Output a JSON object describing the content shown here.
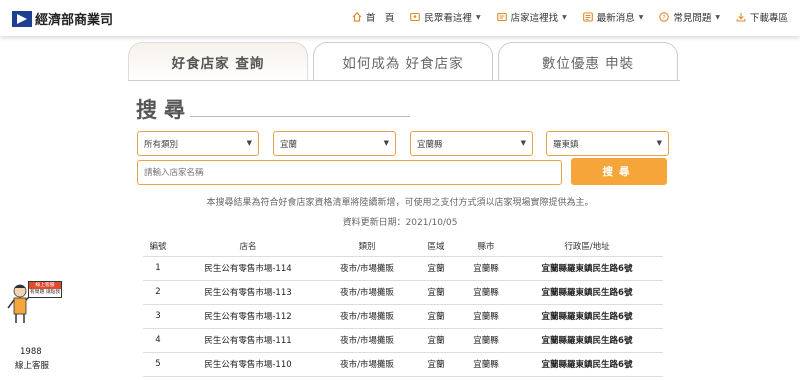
{
  "header": {
    "logo_text": "經濟部商業司",
    "nav": [
      {
        "label": "首　頁",
        "icon": "home-icon"
      },
      {
        "label": "民眾看這裡",
        "icon": "people-icon"
      },
      {
        "label": "店家這裡找",
        "icon": "shop-icon"
      },
      {
        "label": "最新消息",
        "icon": "news-icon"
      },
      {
        "label": "常見問題",
        "icon": "question-icon"
      },
      {
        "label": "下載專區",
        "icon": "download-icon"
      }
    ]
  },
  "tabs": [
    {
      "label": "好食店家 查詢",
      "active": true
    },
    {
      "label": "如何成為 好食店家",
      "active": false
    },
    {
      "label": "數位優惠 申裝",
      "active": false
    }
  ],
  "search": {
    "title": "搜尋",
    "category": "所有類別",
    "area": "宜蘭",
    "county": "宜蘭縣",
    "district": "羅東鎮",
    "keyword_placeholder": "請輸入店家名稱",
    "button": "搜尋",
    "note": "本搜尋結果為符合好食店家資格清單將陸續新增，可使用之支付方式須以店家現場實際提供為主。",
    "updated": "資料更新日期：2021/10/05"
  },
  "table": {
    "headers": [
      "編號",
      "店名",
      "類別",
      "區域",
      "縣市",
      "行政區/地址"
    ],
    "rows": [
      [
        "1",
        "民生公有零售市場-114",
        "夜市/市場攤販",
        "宜蘭",
        "宜蘭縣",
        "宜蘭縣羅東鎮民生路6號"
      ],
      [
        "2",
        "民生公有零售市場-113",
        "夜市/市場攤販",
        "宜蘭",
        "宜蘭縣",
        "宜蘭縣羅東鎮民生路6號"
      ],
      [
        "3",
        "民生公有零售市場-112",
        "夜市/市場攤販",
        "宜蘭",
        "宜蘭縣",
        "宜蘭縣羅東鎮民生路6號"
      ],
      [
        "4",
        "民生公有零售市場-111",
        "夜市/市場攤販",
        "宜蘭",
        "宜蘭縣",
        "宜蘭縣羅東鎮民生路6號"
      ],
      [
        "5",
        "民生公有零售市場-110",
        "夜市/市場攤販",
        "宜蘭",
        "宜蘭縣",
        "宜蘭縣羅東鎮民生路6號"
      ]
    ]
  },
  "chat": {
    "sign_top": "線上客服",
    "sign_bottom": "有問題 請點我",
    "number": "1988",
    "label": "線上客服"
  },
  "colors": {
    "accent": "#f5a53a",
    "border": "#e7a24a",
    "nav_icon": "#e08a2c"
  }
}
